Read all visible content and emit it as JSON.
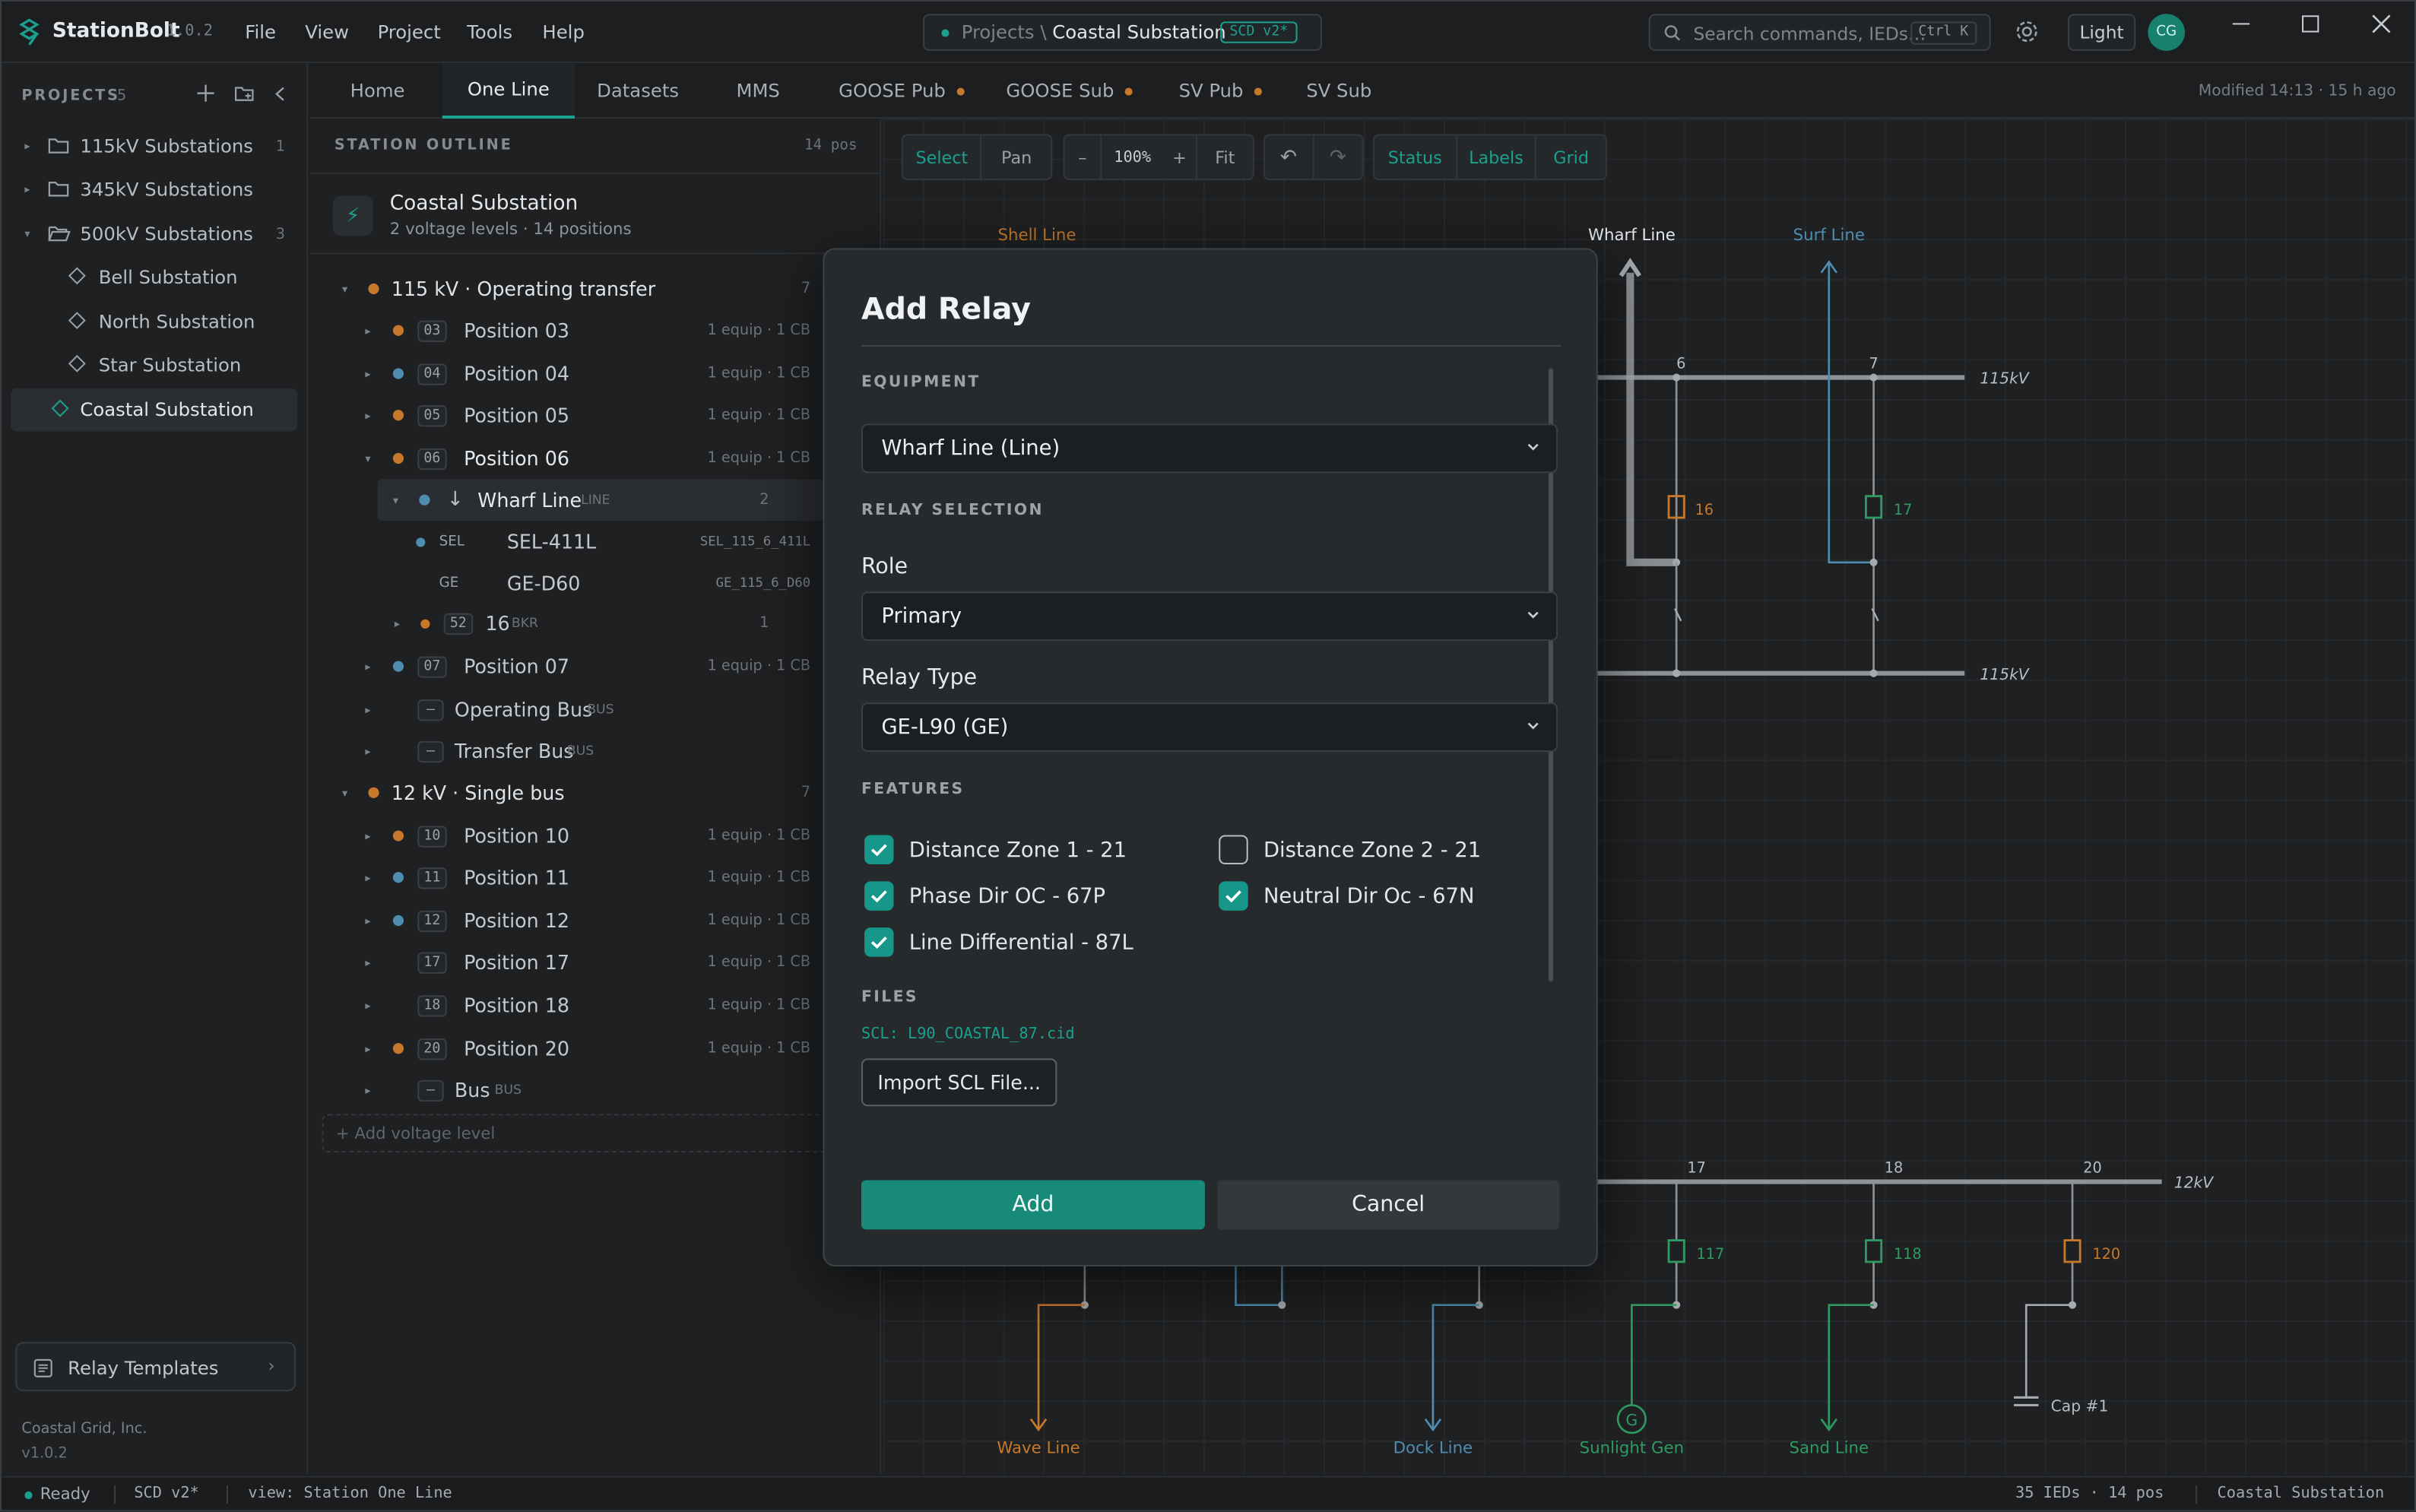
{
  "app": {
    "name": "StationBolt",
    "version": "1.0.2"
  },
  "menu": [
    "File",
    "View",
    "Project",
    "Tools",
    "Help"
  ],
  "breadcrumb": {
    "prefix": "Projects \\",
    "current": "Coastal Substation",
    "badge": "SCD v2*"
  },
  "search": {
    "placeholder": "Search commands, IEDs…",
    "shortcut": "Ctrl K"
  },
  "theme_button": "Light",
  "avatar": "CG",
  "sidebar": {
    "header": "PROJECTS",
    "count": "5",
    "items": [
      {
        "label": "115kV Substations",
        "count": "1"
      },
      {
        "label": "345kV Substations",
        "count": ""
      },
      {
        "label": "500kV Substations",
        "count": "3"
      },
      {
        "label": "Bell Substation",
        "count": ""
      },
      {
        "label": "North Substation",
        "count": ""
      },
      {
        "label": "Star Substation",
        "count": ""
      },
      {
        "label": "Coastal Substation",
        "count": ""
      }
    ],
    "relay_templates": "Relay Templates",
    "org": "Coastal Grid, Inc.",
    "version": "v1.0.2"
  },
  "tabs": [
    {
      "label": "Home",
      "dot": ""
    },
    {
      "label": "One Line",
      "dot": ""
    },
    {
      "label": "Datasets",
      "dot": ""
    },
    {
      "label": "MMS",
      "dot": ""
    },
    {
      "label": "GOOSE Pub",
      "dot": "#c7782a"
    },
    {
      "label": "GOOSE Sub",
      "dot": "#c7782a"
    },
    {
      "label": "SV Pub",
      "dot": "#c7782a"
    },
    {
      "label": "SV Sub",
      "dot": ""
    }
  ],
  "modified": "Modified 14:13 · 15 h ago",
  "outline": {
    "header": "STATION OUTLINE",
    "count": "14 pos",
    "station": {
      "name": "Coastal Substation",
      "sub": "2 voltage levels · 14 positions"
    },
    "rows": [
      {
        "label": "115 kV · Operating transfer",
        "meta": "7"
      },
      {
        "num": "03",
        "label": "Position 03",
        "meta": "1 equip · 1 CB"
      },
      {
        "num": "04",
        "label": "Position 04",
        "meta": "1 equip · 1 CB"
      },
      {
        "num": "05",
        "label": "Position 05",
        "meta": "1 equip · 1 CB"
      },
      {
        "num": "06",
        "label": "Position 06",
        "meta": "1 equip · 1 CB"
      },
      {
        "label": "Wharf Line",
        "tag": "LINE",
        "meta": "2"
      },
      {
        "tag": "SEL",
        "label": "SEL-411L",
        "meta": "SEL_115_6_411L"
      },
      {
        "tag": "GE",
        "label": "GE-D60",
        "meta": "GE_115_6_D60"
      },
      {
        "num": "52",
        "label": "16",
        "tag": "BKR",
        "meta": "1"
      },
      {
        "num": "07",
        "label": "Position 07",
        "meta": "1 equip · 1 CB"
      },
      {
        "label": "Operating Bus",
        "tag": "BUS"
      },
      {
        "label": "Transfer Bus",
        "tag": "BUS"
      },
      {
        "label": "12 kV · Single bus",
        "meta": "7"
      },
      {
        "num": "10",
        "label": "Position 10",
        "meta": "1 equip · 1 CB"
      },
      {
        "num": "11",
        "label": "Position 11",
        "meta": "1 equip · 1 CB"
      },
      {
        "num": "12",
        "label": "Position 12",
        "meta": "1 equip · 1 CB"
      },
      {
        "num": "17",
        "label": "Position 17",
        "meta": "1 equip · 1 CB"
      },
      {
        "num": "18",
        "label": "Position 18",
        "meta": "1 equip · 1 CB"
      },
      {
        "num": "20",
        "label": "Position 20",
        "meta": "1 equip · 1 CB"
      },
      {
        "label": "Bus",
        "tag": "BUS"
      }
    ],
    "add_voltage": "+ Add voltage level"
  },
  "toolbar": {
    "select": "Select",
    "pan": "Pan",
    "zoom_out": "–",
    "zoom": "100%",
    "zoom_in": "+",
    "fit": "Fit",
    "undo": "↶",
    "redo": "↷",
    "status": "Status",
    "labels": "Labels",
    "grid": "Grid"
  },
  "diagram": {
    "top_feeders": [
      "Shell Line",
      "Wharf Line",
      "Surf Line"
    ],
    "bus_115_top": "115kV",
    "bus_115_bottom": "115kV",
    "bus_12": "12kV",
    "bay_numbers_top": [
      "6",
      "7"
    ],
    "breakers_top": [
      "16",
      "17"
    ],
    "bay_numbers_bottom": [
      "17",
      "18",
      "20"
    ],
    "breakers_bottom": [
      "117",
      "118",
      "120"
    ],
    "bottom_feeders": [
      "Wave Line",
      "Dock Line",
      "Sunlight Gen",
      "Sand Line",
      "Cap #1"
    ],
    "gen_symbol": "G"
  },
  "modal": {
    "title": "Add Relay",
    "equipment_section": "EQUIPMENT",
    "equipment_value": "Wharf Line (Line)",
    "relay_section": "RELAY SELECTION",
    "role_label": "Role",
    "role_value": "Primary",
    "type_label": "Relay Type",
    "type_value": "GE-L90 (GE)",
    "features_section": "FEATURES",
    "features": [
      {
        "label": "Distance Zone 1 - 21",
        "checked": true
      },
      {
        "label": "Distance Zone 2 - 21",
        "checked": false
      },
      {
        "label": "Phase Dir OC - 67P",
        "checked": true
      },
      {
        "label": "Neutral Dir Oc - 67N",
        "checked": true
      },
      {
        "label": "Line Differential - 87L",
        "checked": true
      }
    ],
    "files_section": "FILES",
    "file": "SCL: L90_COASTAL_87.cid",
    "import": "Import SCL File...",
    "add": "Add",
    "cancel": "Cancel"
  },
  "statusbar": {
    "ready": "Ready",
    "scd": "SCD v2*",
    "view": "view: Station One Line",
    "counts": "35 IEDs · 14 pos",
    "station": "Coastal Substation"
  },
  "colors": {
    "accent": "#1aa08f",
    "orange": "#c7782a",
    "blue": "#4f8db0",
    "green": "#2f9a62"
  }
}
